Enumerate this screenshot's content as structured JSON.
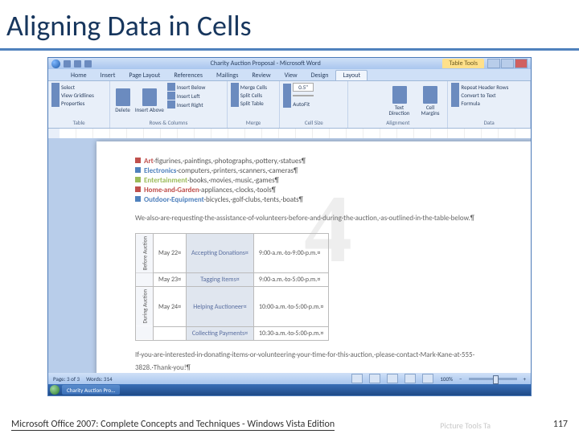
{
  "slide": {
    "title": "Aligning Data in Cells",
    "footer_text": "Microsoft Office 2007: Complete Concepts and Techniques - Windows Vista Edition",
    "page_number": "117",
    "ghost_right": "Picture Tools     Ta"
  },
  "window": {
    "title": "Charity Auction Proposal - Microsoft Word",
    "context_tab_group": "Table Tools"
  },
  "tabs": [
    "Home",
    "Insert",
    "Page Layout",
    "References",
    "Mailings",
    "Review",
    "View",
    "Design",
    "Layout"
  ],
  "active_tab_index": 8,
  "ribbon_groups": {
    "table": {
      "label": "Table",
      "items": [
        "Select",
        "View Gridlines",
        "Properties"
      ]
    },
    "rows_columns": {
      "label": "Rows & Columns",
      "delete": "Delete",
      "items": [
        "Insert Above",
        "Insert Below",
        "Insert Left",
        "Insert Right"
      ]
    },
    "merge": {
      "label": "Merge",
      "items": [
        "Merge Cells",
        "Split Cells",
        "Split Table"
      ]
    },
    "cell_size": {
      "label": "Cell Size",
      "height": "0.5\"",
      "width": "",
      "autofit": "AutoFit"
    },
    "alignment": {
      "label": "Alignment",
      "text_direction": "Text Direction",
      "cell_margins": "Cell Margins"
    },
    "data": {
      "label": "Data",
      "items": [
        "Repeat Header Rows",
        "Convert to Text",
        "Formula"
      ]
    }
  },
  "document": {
    "bullets": [
      {
        "color": "#c0504d",
        "category": "Art",
        "desc": "·figurines,·paintings,·photographs,·pottery,·statues¶"
      },
      {
        "color": "#4f81bd",
        "category": "Electronics",
        "desc": "·computers,·printers,·scanners,·cameras¶"
      },
      {
        "color": "#9bbb59",
        "category": "Entertainment",
        "desc": "·books,·movies,·music,·games¶"
      },
      {
        "color": "#c0504d",
        "category": "Home·and·Garden",
        "desc": "·appliances,·clocks,·tools¶"
      },
      {
        "color": "#4f81bd",
        "category": "Outdoor·Equipment",
        "desc": "·bicycles,·golf·clubs,·tents,·boats¶"
      }
    ],
    "paragraph1": "We·also·are·requesting·the·assistance·of·volunteers·before·and·during·the·auction,·as·outlined·in·the·table·below.¶",
    "paragraph2": "If·you·are·interested·in·donating·items·or·volunteering·your·time·for·this·auction,·please·contact·Mark·Kane·at·555-3828.·Thank·you!¶",
    "watermark": "4"
  },
  "chart_data": {
    "type": "table",
    "row_headers": [
      "Before Auction",
      "During Auction"
    ],
    "rows": [
      {
        "group": "Before Auction",
        "date": "May 22¤",
        "task": "Accepting Donations¤",
        "time": "9:00·a.m.·to·9:00·p.m.¤"
      },
      {
        "group": "Before Auction",
        "date": "May 23¤",
        "task": "Tagging Items¤",
        "time": "9:00·a.m.·to·5:00·p.m.¤"
      },
      {
        "group": "During Auction",
        "date": "May 24¤",
        "task": "Helping Auctioneer¤",
        "time": "10:00·a.m.·to·5:00·p.m.¤"
      },
      {
        "group": "During Auction",
        "date": "",
        "task": "Collecting Payments¤",
        "time": "10:30·a.m.·to·5:00·p.m.¤"
      }
    ]
  },
  "status_bar": {
    "page": "Page: 3 of 3",
    "words": "Words: 314",
    "zoom": "100%"
  },
  "taskbar": {
    "item": "Charity Auction Pro..."
  }
}
